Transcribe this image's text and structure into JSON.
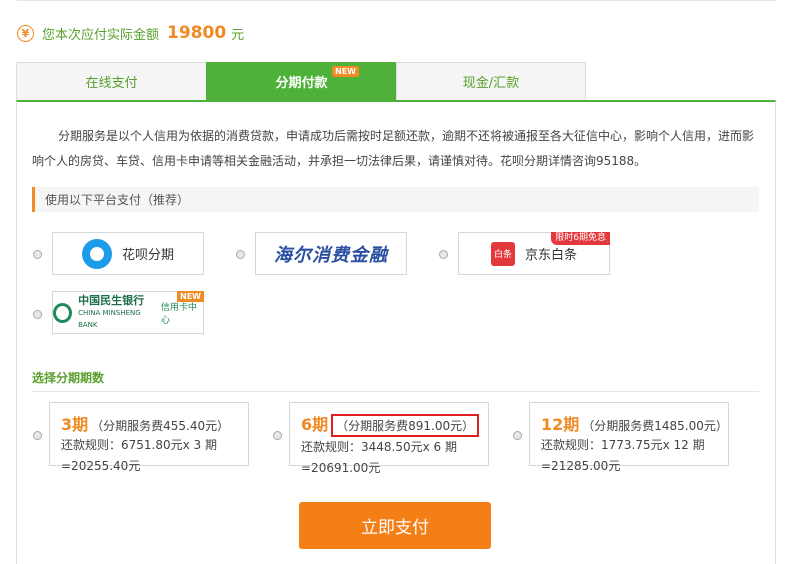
{
  "summary": {
    "label": "您本次应付实际金额",
    "amount": "19800",
    "unit": "元"
  },
  "tabs": [
    {
      "label": "在线支付"
    },
    {
      "label": "分期付款",
      "badge": "NEW"
    },
    {
      "label": "现金/汇款"
    }
  ],
  "notice": "分期服务是以个人信用为依据的消费贷款，申请成功后需按时足额还款，逾期不还将被通报至各大征信中心，影响个人信用，进而影响个人的房贷、车贷、信用卡申请等相关金融活动，并承担一切法律后果，请谨慎对待。花呗分期详情咨询95188。",
  "platforms": {
    "heading": "使用以下平台支付（推荐）",
    "items": [
      {
        "name": "花呗分期"
      },
      {
        "name": "海尔消费金融"
      },
      {
        "name": "京东白条",
        "logo_text": "白条",
        "badge": "限时6期免息"
      },
      {
        "name": "中国民生银行",
        "sub": "CHINA MINSHENG BANK",
        "extra": "信用卡中心",
        "badge": "NEW"
      }
    ]
  },
  "periods": {
    "title": "选择分期期数",
    "plans": [
      {
        "num": "3期",
        "fee": "（分期服务费455.40元）",
        "rule1": "还款规则：6751.80元x 3 期",
        "rule2": "=20255.40元"
      },
      {
        "num": "6期",
        "fee": "（分期服务费891.00元）",
        "rule1": "还款规则：3448.50元x 6 期",
        "rule2": "=20691.00元"
      },
      {
        "num": "12期",
        "fee": "（分期服务费1485.00元）",
        "rule1": "还款规则：1773.75元x 12 期",
        "rule2": "=21285.00元"
      }
    ]
  },
  "pay_button": "立即支付",
  "colors": {
    "green": "#4eb13a",
    "orange": "#f08a24",
    "button": "#f57f17",
    "red": "#e02020"
  }
}
